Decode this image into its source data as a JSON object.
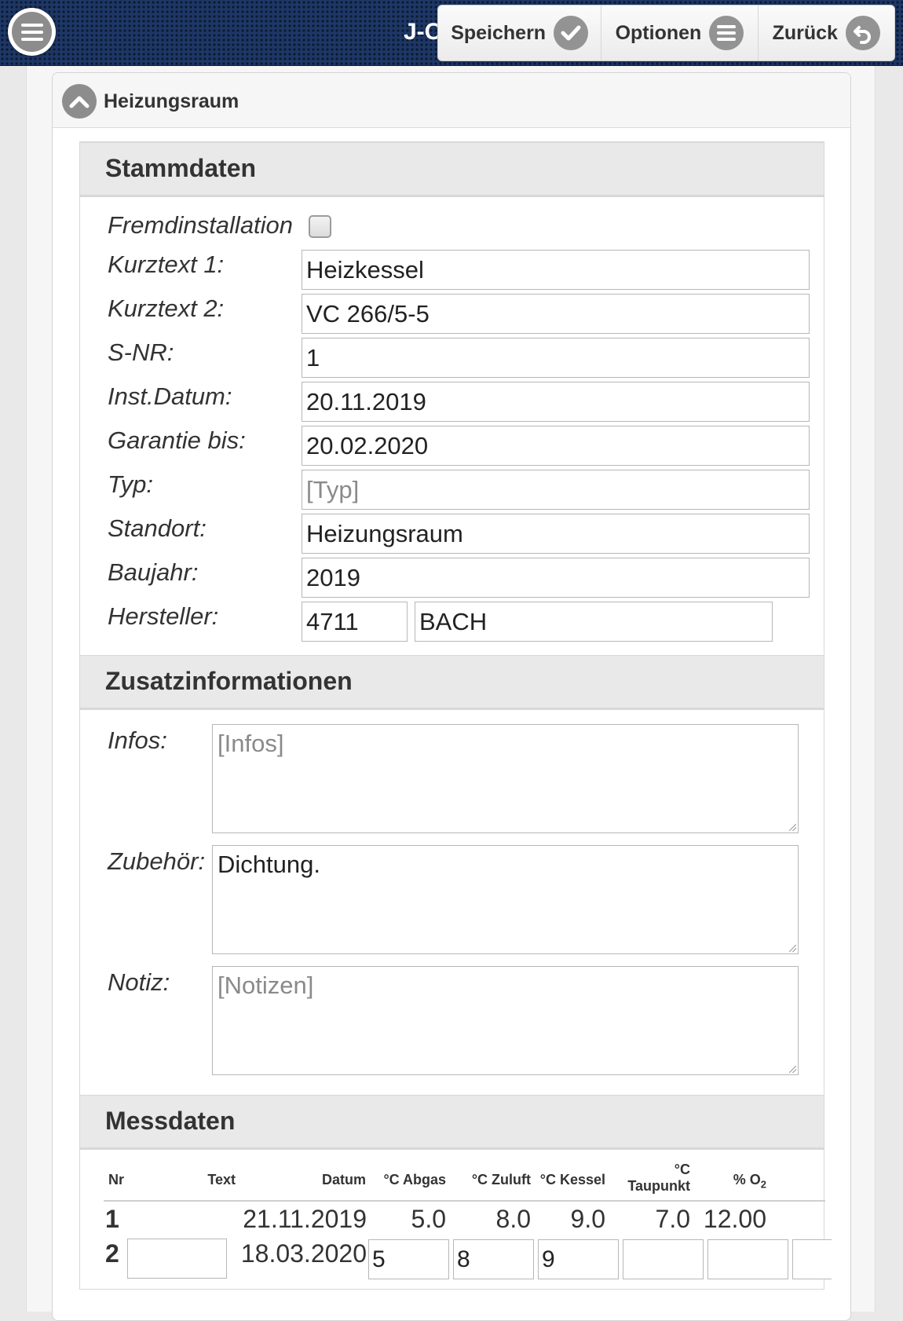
{
  "header": {
    "app_title": "J-C",
    "buttons": {
      "save": "Speichern",
      "options": "Optionen",
      "back": "Zurück"
    }
  },
  "collapsible": {
    "title": "Heizungsraum"
  },
  "stammdaten": {
    "title": "Stammdaten",
    "fremdinstallation_label": "Fremdinstallation",
    "fremdinstallation_checked": false,
    "fields": {
      "kurztext1": {
        "label": "Kurztext 1:",
        "value": "Heizkessel"
      },
      "kurztext2": {
        "label": "Kurztext 2:",
        "value": "VC 266/5-5"
      },
      "snr": {
        "label": "S-NR:",
        "value": "1"
      },
      "inst_datum": {
        "label": "Inst.Datum:",
        "value": "20.11.2019"
      },
      "garantie": {
        "label": "Garantie bis:",
        "value": "20.02.2020"
      },
      "typ": {
        "label": "Typ:",
        "placeholder": "[Typ]"
      },
      "standort": {
        "label": "Standort:",
        "value": "Heizungsraum"
      },
      "baujahr": {
        "label": "Baujahr:",
        "value": "2019"
      },
      "hersteller": {
        "label": "Hersteller:",
        "code": "4711",
        "name": "BACH"
      }
    }
  },
  "zusatz": {
    "title": "Zusatzinformationen",
    "infos": {
      "label": "Infos:",
      "placeholder": "[Infos]"
    },
    "zubehoer": {
      "label": "Zubehör:",
      "value": "Dichtung."
    },
    "notiz": {
      "label": "Notiz:",
      "placeholder": "[Notizen]"
    }
  },
  "messdaten": {
    "title": "Messdaten",
    "columns": {
      "nr": "Nr",
      "text": "Text",
      "datum": "Datum",
      "abgas": "°C Abgas",
      "zuluft": "°C Zuluft",
      "kessel": "°C Kessel",
      "taupunkt_unit": "°C",
      "taupunkt": "Taupunkt",
      "o2_prefix": "% O",
      "o2_sub": "2"
    },
    "rows": [
      {
        "nr": "1",
        "text": "",
        "datum": "21.11.2019",
        "abgas": "5.0",
        "zuluft": "8.0",
        "kessel": "9.0",
        "taupunkt": "7.0",
        "o2": "12.00"
      },
      {
        "nr": "2",
        "text": "",
        "datum": "18.03.2020",
        "abgas": "5",
        "zuluft": "8",
        "kessel": "9",
        "taupunkt": "",
        "o2": ""
      }
    ]
  }
}
